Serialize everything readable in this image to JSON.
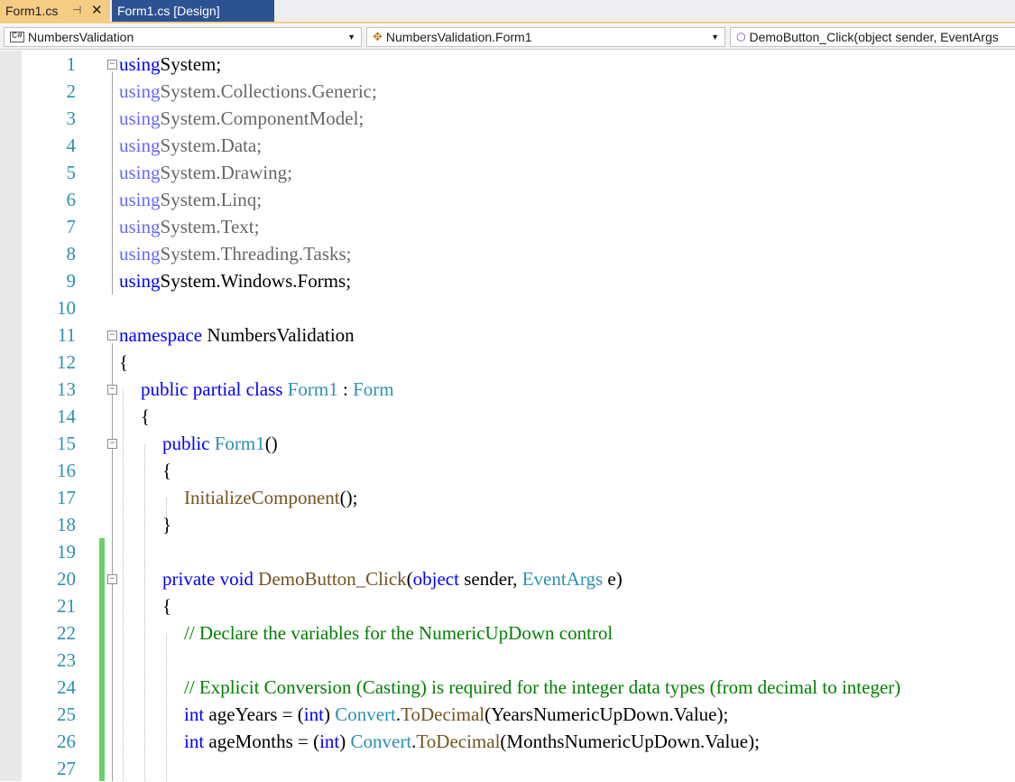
{
  "tabs": [
    {
      "label": "Form1.cs",
      "active": true,
      "pin_icon": "pin-icon",
      "close_icon": "close-icon"
    },
    {
      "label": "Form1.cs [Design]",
      "active": false
    }
  ],
  "navbar": {
    "project": {
      "icon": "csharp-project-icon",
      "icon_text": "C#",
      "value": "NumbersValidation"
    },
    "type": {
      "icon": "class-icon",
      "value": "NumbersValidation.Form1"
    },
    "member": {
      "icon": "method-icon",
      "value": "DemoButton_Click(object sender, EventArgs"
    }
  },
  "colors": {
    "keyword": "#0000ff",
    "type": "#2b91af",
    "method": "#74531f",
    "comment": "#008000",
    "line_number": "#2b91af",
    "active_tab": "#f5cc84",
    "inactive_tab": "#2d5294",
    "change_bar": "#6bd06b"
  },
  "lines": [
    {
      "n": "1",
      "indent": 0,
      "fold": "minus",
      "tokens": [
        [
          "kw",
          "using"
        ],
        [
          "",
          "System;"
        ]
      ]
    },
    {
      "n": "2",
      "indent": 0,
      "dim": true,
      "tokens": [
        [
          "kw",
          "using"
        ],
        [
          "",
          "System.Collections.Generic;"
        ]
      ]
    },
    {
      "n": "3",
      "indent": 0,
      "dim": true,
      "tokens": [
        [
          "kw",
          "using"
        ],
        [
          "",
          "System.ComponentModel;"
        ]
      ]
    },
    {
      "n": "4",
      "indent": 0,
      "dim": true,
      "tokens": [
        [
          "kw",
          "using"
        ],
        [
          "",
          "System.Data;"
        ]
      ]
    },
    {
      "n": "5",
      "indent": 0,
      "dim": true,
      "tokens": [
        [
          "kw",
          "using"
        ],
        [
          "",
          "System.Drawing;"
        ]
      ]
    },
    {
      "n": "6",
      "indent": 0,
      "dim": true,
      "tokens": [
        [
          "kw",
          "using"
        ],
        [
          "",
          "System.Linq;"
        ]
      ]
    },
    {
      "n": "7",
      "indent": 0,
      "dim": true,
      "tokens": [
        [
          "kw",
          "using"
        ],
        [
          "",
          "System.Text;"
        ]
      ]
    },
    {
      "n": "8",
      "indent": 0,
      "dim": true,
      "tokens": [
        [
          "kw",
          "using"
        ],
        [
          "",
          "System.Threading.Tasks;"
        ]
      ]
    },
    {
      "n": "9",
      "indent": 0,
      "tokens": [
        [
          "kw",
          "using"
        ],
        [
          "",
          "System.Windows.Forms;"
        ]
      ]
    },
    {
      "n": "10",
      "indent": 0,
      "tokens": []
    },
    {
      "n": "11",
      "indent": 0,
      "fold": "minus",
      "tokens": [
        [
          "kw",
          "namespace"
        ],
        [
          "",
          " NumbersValidation"
        ]
      ]
    },
    {
      "n": "12",
      "indent": 0,
      "tokens": [
        [
          "",
          "{"
        ]
      ]
    },
    {
      "n": "13",
      "indent": 1,
      "fold": "minus",
      "tokens": [
        [
          "kw",
          "public"
        ],
        [
          "",
          " "
        ],
        [
          "kw",
          "partial"
        ],
        [
          "",
          " "
        ],
        [
          "kw",
          "class"
        ],
        [
          "",
          " "
        ],
        [
          "ty",
          "Form1"
        ],
        [
          "",
          " : "
        ],
        [
          "ty",
          "Form"
        ]
      ]
    },
    {
      "n": "14",
      "indent": 1,
      "tokens": [
        [
          "",
          "{"
        ]
      ]
    },
    {
      "n": "15",
      "indent": 2,
      "fold": "minus",
      "tokens": [
        [
          "kw",
          "public"
        ],
        [
          "",
          " "
        ],
        [
          "ty",
          "Form1"
        ],
        [
          "",
          "()"
        ]
      ]
    },
    {
      "n": "16",
      "indent": 2,
      "tokens": [
        [
          "",
          "{"
        ]
      ]
    },
    {
      "n": "17",
      "indent": 3,
      "tokens": [
        [
          "fn",
          "InitializeComponent"
        ],
        [
          "",
          "();"
        ]
      ]
    },
    {
      "n": "18",
      "indent": 2,
      "tokens": [
        [
          "",
          "}"
        ]
      ]
    },
    {
      "n": "19",
      "indent": 0,
      "tokens": []
    },
    {
      "n": "20",
      "indent": 2,
      "fold": "minus",
      "tokens": [
        [
          "kw",
          "private"
        ],
        [
          "",
          " "
        ],
        [
          "kw",
          "void"
        ],
        [
          "",
          " "
        ],
        [
          "fn",
          "DemoButton_Click"
        ],
        [
          "",
          "("
        ],
        [
          "kw",
          "object"
        ],
        [
          "",
          " sender, "
        ],
        [
          "ty",
          "EventArgs"
        ],
        [
          "",
          " e)"
        ]
      ]
    },
    {
      "n": "21",
      "indent": 2,
      "tokens": [
        [
          "",
          "{"
        ]
      ]
    },
    {
      "n": "22",
      "indent": 3,
      "tokens": [
        [
          "cm",
          "// Declare the variables for the NumericUpDown control"
        ]
      ]
    },
    {
      "n": "23",
      "indent": 0,
      "tokens": []
    },
    {
      "n": "24",
      "indent": 3,
      "tokens": [
        [
          "cm",
          "// Explicit Conversion (Casting) is required for the integer data types (from decimal to integer)"
        ]
      ]
    },
    {
      "n": "25",
      "indent": 3,
      "tokens": [
        [
          "kw",
          "int"
        ],
        [
          "",
          " ageYears = ("
        ],
        [
          "kw",
          "int"
        ],
        [
          "",
          ") "
        ],
        [
          "ty",
          "Convert"
        ],
        [
          "",
          "."
        ],
        [
          "fn",
          "ToDecimal"
        ],
        [
          "",
          "(YearsNumericUpDown.Value);"
        ]
      ]
    },
    {
      "n": "26",
      "indent": 3,
      "tokens": [
        [
          "kw",
          "int"
        ],
        [
          "",
          " ageMonths = ("
        ],
        [
          "kw",
          "int"
        ],
        [
          "",
          ") "
        ],
        [
          "ty",
          "Convert"
        ],
        [
          "",
          "."
        ],
        [
          "fn",
          "ToDecimal"
        ],
        [
          "",
          "(MonthsNumericUpDown.Value);"
        ]
      ]
    },
    {
      "n": "27",
      "indent": 0,
      "tokens": []
    }
  ]
}
